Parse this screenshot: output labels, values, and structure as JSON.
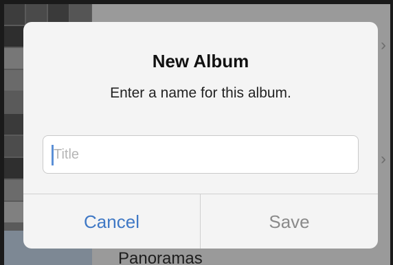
{
  "background": {
    "list_item_label": "Panoramas"
  },
  "dialog": {
    "title": "New Album",
    "message": "Enter a name for this album.",
    "input_placeholder": "Title",
    "input_value": "",
    "cancel_label": "Cancel",
    "save_label": "Save"
  },
  "colors": {
    "accent": "#3f78c5",
    "disabled": "#8a8a8a",
    "dialog_bg": "#f4f4f4"
  }
}
